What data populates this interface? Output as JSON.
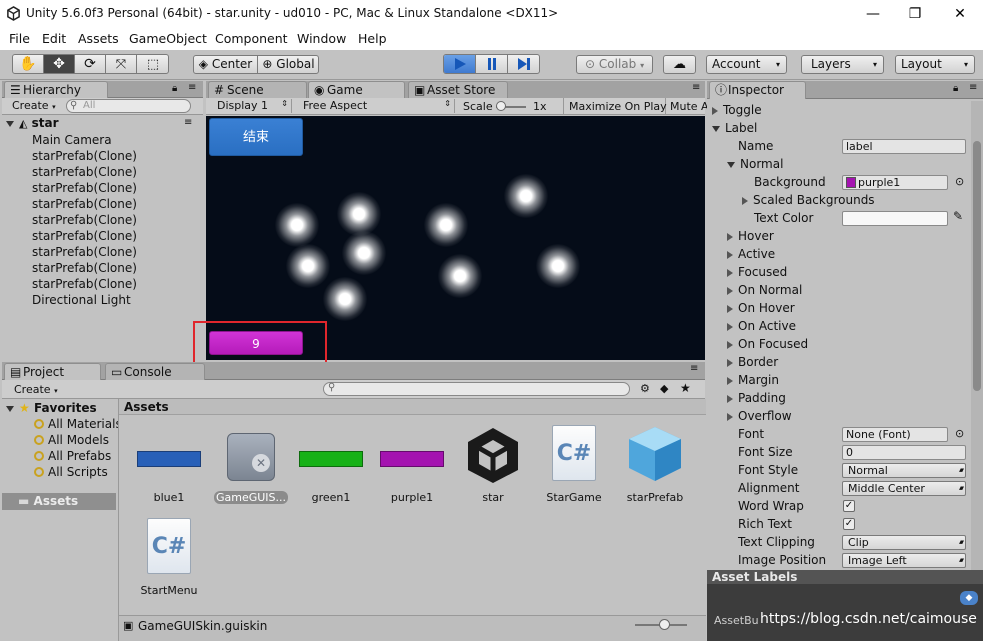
{
  "window": {
    "title": "Unity 5.6.0f3 Personal (64bit) - star.unity - ud010 - PC, Mac & Linux Standalone <DX11>",
    "minimize": "—",
    "maximize": "❐",
    "close": "✕"
  },
  "menu": [
    "File",
    "Edit",
    "Assets",
    "GameObject",
    "Component",
    "Window",
    "Help"
  ],
  "toolbar": {
    "pivot": "Center",
    "space": "Global",
    "collab": "Collab",
    "account": "Account",
    "layers": "Layers",
    "layout": "Layout"
  },
  "hierarchy": {
    "tab": "Hierarchy",
    "create": "Create",
    "search_placeholder": "All",
    "scene": "star",
    "items": [
      "Main Camera",
      "starPrefab(Clone)",
      "starPrefab(Clone)",
      "starPrefab(Clone)",
      "starPrefab(Clone)",
      "starPrefab(Clone)",
      "starPrefab(Clone)",
      "starPrefab(Clone)",
      "starPrefab(Clone)",
      "starPrefab(Clone)",
      "Directional Light"
    ]
  },
  "center_tabs": {
    "scene": "Scene",
    "game": "Game",
    "asset_store": "Asset Store"
  },
  "game": {
    "display": "Display 1",
    "aspect": "Free Aspect",
    "scale_label": "Scale",
    "scale_value": "1x",
    "maximize": "Maximize On Play",
    "mute": "Mute A",
    "end_button": "结束",
    "score_label": "9",
    "colors": {
      "background": "#050c18",
      "end_button": "#2a6fc2",
      "score_label": "#c21fc7",
      "highlight": "#e0262c"
    }
  },
  "project": {
    "tab": "Project",
    "console_tab": "Console",
    "create": "Create",
    "favorites_label": "Favorites",
    "favorites": [
      "All Materials",
      "All Models",
      "All Prefabs",
      "All Scripts"
    ],
    "assets_root": "Assets",
    "assets_header": "Assets",
    "assets": [
      {
        "name": "blue1",
        "kind": "material",
        "color": "#2860b8"
      },
      {
        "name": "GameGUIS...",
        "kind": "guiskin",
        "selected": true
      },
      {
        "name": "green1",
        "kind": "material",
        "color": "#17b117"
      },
      {
        "name": "purple1",
        "kind": "material",
        "color": "#a413b0"
      },
      {
        "name": "star",
        "kind": "unity-scene"
      },
      {
        "name": "StarGame",
        "kind": "script"
      },
      {
        "name": "starPrefab",
        "kind": "prefab"
      },
      {
        "name": "StartMenu",
        "kind": "script"
      }
    ],
    "footer_file": "GameGUISkin.guiskin"
  },
  "inspector": {
    "tab": "Inspector",
    "toggle": "Toggle",
    "label": "Label",
    "name_label": "Name",
    "name_value": "label",
    "normal": "Normal",
    "background_label": "Background",
    "background_value": "purple1",
    "scaled_backgrounds": "Scaled Backgrounds",
    "text_color_label": "Text Color",
    "states": [
      "Hover",
      "Active",
      "Focused",
      "On Normal",
      "On Hover",
      "On Active",
      "On Focused",
      "Border",
      "Margin",
      "Padding",
      "Overflow"
    ],
    "font_label": "Font",
    "font_value": "None (Font)",
    "font_size_label": "Font Size",
    "font_size_value": "0",
    "font_style_label": "Font Style",
    "font_style_value": "Normal",
    "alignment_label": "Alignment",
    "alignment_value": "Middle Center",
    "word_wrap_label": "Word Wrap",
    "rich_text_label": "Rich Text",
    "text_clipping_label": "Text Clipping",
    "text_clipping_value": "Clip",
    "image_position_label": "Image Position",
    "image_position_value": "Image Left",
    "asset_labels": "Asset Labels",
    "assetbundle": "AssetBu"
  },
  "watermark": "https://blog.csdn.net/caimouse"
}
